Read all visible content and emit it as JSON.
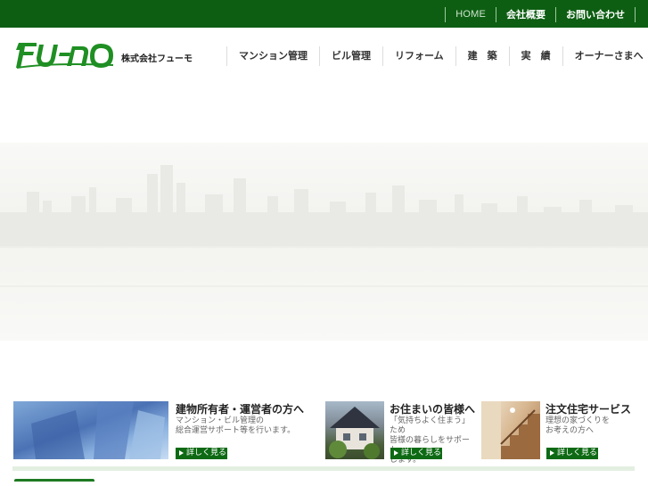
{
  "header": {
    "links": [
      "HOME",
      "会社概要",
      "お問い合わせ"
    ],
    "company_name": "株式会社フューモ",
    "logo_text": "FU-MO"
  },
  "nav": {
    "items": [
      "マンション管理",
      "ビル管理",
      "リフォーム",
      "建　築",
      "実　績",
      "オーナーさまへ"
    ]
  },
  "cards": [
    {
      "title": "建物所有者・運営者の方へ",
      "desc": [
        "マンション・ビル管理の",
        "総合運営サポート等を行います。"
      ],
      "more": "詳しく見る"
    },
    {
      "title": "お住まいの皆様へ",
      "desc": [
        "「気持ちよく住まう」ため",
        "皆様の暮らしをサポート",
        "します。"
      ],
      "more": "詳しく見る"
    },
    {
      "title": "注文住宅サービス",
      "desc": [
        "理想の家づくりを",
        "お考えの方へ"
      ],
      "more": "詳しく見る"
    }
  ],
  "colors": {
    "brand_green": "#0d5e12",
    "logo_green": "#1f8f23"
  }
}
